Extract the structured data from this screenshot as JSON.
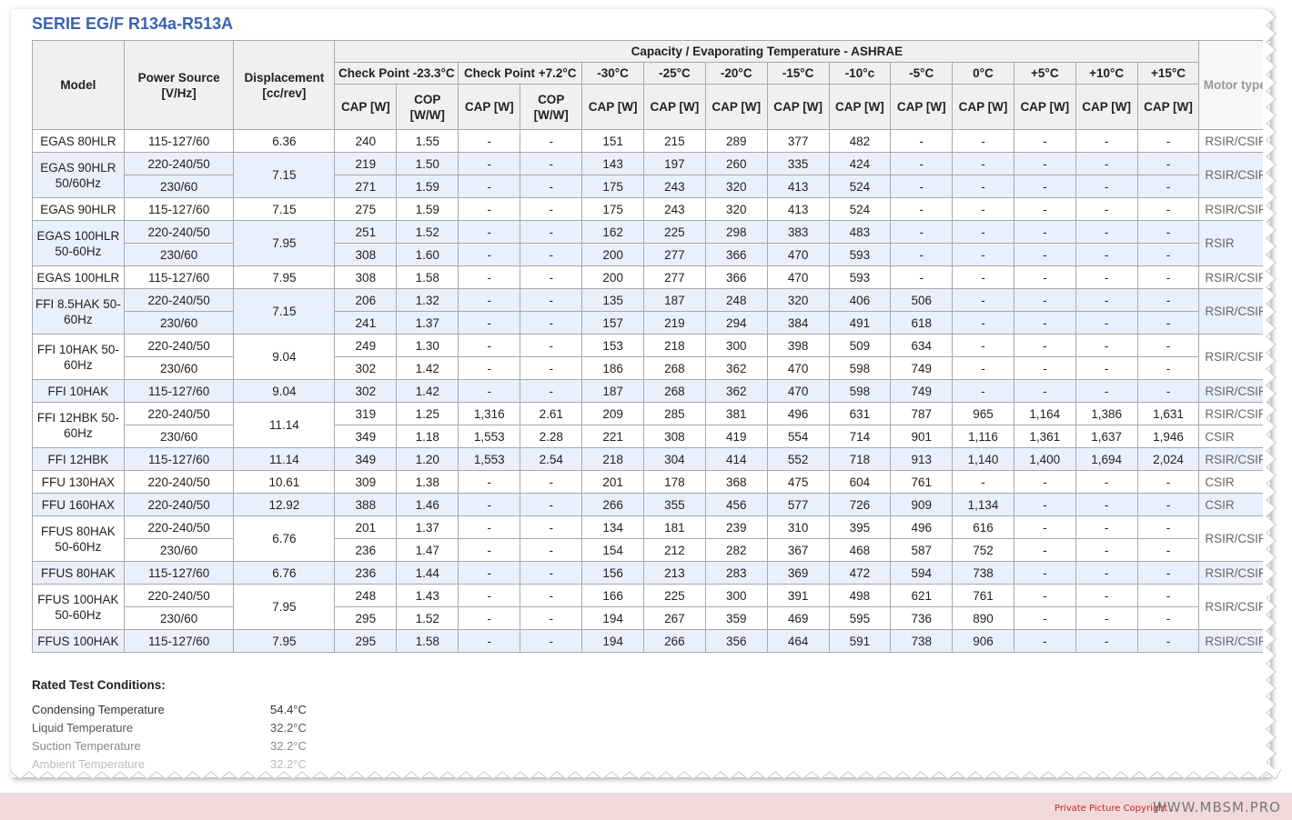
{
  "title": "SERIE EG/F R134a-R513A",
  "headers": {
    "model": "Model",
    "power": "Power Source [V/Hz]",
    "displacement": "Displacement [cc/rev]",
    "capacity_group": "Capacity / Evaporating Temperature - ASHRAE",
    "motor": "Motor type",
    "check1": "Check Point -23.3°C",
    "check2": "Check Point +7.2°C",
    "temps": [
      "-30°C",
      "-25°C",
      "-20°C",
      "-15°C",
      "-10°c",
      "-5°C",
      "0°C",
      "+5°C",
      "+10°C",
      "+15°C"
    ],
    "cap": "CAP [W]",
    "cop": "COP [W/W]"
  },
  "groups": [
    {
      "model": "EGAS 80HLR",
      "disp": "6.36",
      "rows": [
        {
          "power": "115-127/60",
          "values": [
            "240",
            "1.55",
            "-",
            "-",
            "151",
            "215",
            "289",
            "377",
            "482",
            "-",
            "-",
            "-",
            "-",
            "-"
          ],
          "motor": "RSIR/CSIR"
        }
      ]
    },
    {
      "model": "EGAS 90HLR 50/60Hz",
      "disp": "7.15",
      "motor": "RSIR/CSIR",
      "rows": [
        {
          "power": "220-240/50",
          "values": [
            "219",
            "1.50",
            "-",
            "-",
            "143",
            "197",
            "260",
            "335",
            "424",
            "-",
            "-",
            "-",
            "-",
            "-"
          ]
        },
        {
          "power": "230/60",
          "values": [
            "271",
            "1.59",
            "-",
            "-",
            "175",
            "243",
            "320",
            "413",
            "524",
            "-",
            "-",
            "-",
            "-",
            "-"
          ]
        }
      ]
    },
    {
      "model": "EGAS 90HLR",
      "disp": "7.15",
      "rows": [
        {
          "power": "115-127/60",
          "values": [
            "275",
            "1.59",
            "-",
            "-",
            "175",
            "243",
            "320",
            "413",
            "524",
            "-",
            "-",
            "-",
            "-",
            "-"
          ],
          "motor": "RSIR/CSIR"
        }
      ]
    },
    {
      "model": "EGAS 100HLR 50-60Hz",
      "disp": "7.95",
      "motor": "RSIR",
      "rows": [
        {
          "power": "220-240/50",
          "values": [
            "251",
            "1.52",
            "-",
            "-",
            "162",
            "225",
            "298",
            "383",
            "483",
            "-",
            "-",
            "-",
            "-",
            "-"
          ]
        },
        {
          "power": "230/60",
          "values": [
            "308",
            "1.60",
            "-",
            "-",
            "200",
            "277",
            "366",
            "470",
            "593",
            "-",
            "-",
            "-",
            "-",
            "-"
          ]
        }
      ]
    },
    {
      "model": "EGAS 100HLR",
      "disp": "7.95",
      "rows": [
        {
          "power": "115-127/60",
          "values": [
            "308",
            "1.58",
            "-",
            "-",
            "200",
            "277",
            "366",
            "470",
            "593",
            "-",
            "-",
            "-",
            "-",
            "-"
          ],
          "motor": "RSIR/CSIR"
        }
      ]
    },
    {
      "model": "FFI 8.5HAK 50-60Hz",
      "disp": "7.15",
      "motor": "RSIR/CSIR",
      "rows": [
        {
          "power": "220-240/50",
          "values": [
            "206",
            "1.32",
            "-",
            "-",
            "135",
            "187",
            "248",
            "320",
            "406",
            "506",
            "-",
            "-",
            "-",
            "-"
          ]
        },
        {
          "power": "230/60",
          "values": [
            "241",
            "1.37",
            "-",
            "-",
            "157",
            "219",
            "294",
            "384",
            "491",
            "618",
            "-",
            "-",
            "-",
            "-"
          ]
        }
      ]
    },
    {
      "model": "FFI 10HAK 50-60Hz",
      "disp": "9.04",
      "motor": "RSIR/CSIR",
      "rows": [
        {
          "power": "220-240/50",
          "values": [
            "249",
            "1.30",
            "-",
            "-",
            "153",
            "218",
            "300",
            "398",
            "509",
            "634",
            "-",
            "-",
            "-",
            "-"
          ]
        },
        {
          "power": "230/60",
          "values": [
            "302",
            "1.42",
            "-",
            "-",
            "186",
            "268",
            "362",
            "470",
            "598",
            "749",
            "-",
            "-",
            "-",
            "-"
          ]
        }
      ]
    },
    {
      "model": "FFI 10HAK",
      "disp": "9.04",
      "rows": [
        {
          "power": "115-127/60",
          "values": [
            "302",
            "1.42",
            "-",
            "-",
            "187",
            "268",
            "362",
            "470",
            "598",
            "749",
            "-",
            "-",
            "-",
            "-"
          ],
          "motor": "RSIR/CSIR"
        }
      ]
    },
    {
      "model": "FFI 12HBK 50-60Hz",
      "disp": "11.14",
      "rows": [
        {
          "power": "220-240/50",
          "values": [
            "319",
            "1.25",
            "1,316",
            "2.61",
            "209",
            "285",
            "381",
            "496",
            "631",
            "787",
            "965",
            "1,164",
            "1,386",
            "1,631"
          ],
          "motor": "RSIR/CSIR"
        },
        {
          "power": "230/60",
          "values": [
            "349",
            "1.18",
            "1,553",
            "2.28",
            "221",
            "308",
            "419",
            "554",
            "714",
            "901",
            "1,116",
            "1,361",
            "1,637",
            "1,946"
          ],
          "motor": "CSIR"
        }
      ]
    },
    {
      "model": "FFI 12HBK",
      "disp": "11.14",
      "rows": [
        {
          "power": "115-127/60",
          "values": [
            "349",
            "1.20",
            "1,553",
            "2.54",
            "218",
            "304",
            "414",
            "552",
            "718",
            "913",
            "1,140",
            "1,400",
            "1,694",
            "2,024"
          ],
          "motor": "RSIR/CSIR"
        }
      ]
    },
    {
      "model": "FFU 130HAX",
      "disp": "10.61",
      "rows": [
        {
          "power": "220-240/50",
          "values": [
            "309",
            "1.38",
            "-",
            "-",
            "201",
            "178",
            "368",
            "475",
            "604",
            "761",
            "-",
            "-",
            "-",
            "-"
          ],
          "motor": "CSIR"
        }
      ]
    },
    {
      "model": "FFU 160HAX",
      "disp": "12.92",
      "rows": [
        {
          "power": "220-240/50",
          "values": [
            "388",
            "1.46",
            "-",
            "-",
            "266",
            "355",
            "456",
            "577",
            "726",
            "909",
            "1,134",
            "-",
            "-",
            "-"
          ],
          "motor": "CSIR"
        }
      ]
    },
    {
      "model": "FFUS 80HAK 50-60Hz",
      "disp": "6.76",
      "motor": "RSIR/CSIR",
      "rows": [
        {
          "power": "220-240/50",
          "values": [
            "201",
            "1.37",
            "-",
            "-",
            "134",
            "181",
            "239",
            "310",
            "395",
            "496",
            "616",
            "-",
            "-",
            "-"
          ]
        },
        {
          "power": "230/60",
          "values": [
            "236",
            "1.47",
            "-",
            "-",
            "154",
            "212",
            "282",
            "367",
            "468",
            "587",
            "752",
            "-",
            "-",
            "-"
          ]
        }
      ]
    },
    {
      "model": "FFUS 80HAK",
      "disp": "6.76",
      "rows": [
        {
          "power": "115-127/60",
          "values": [
            "236",
            "1.44",
            "-",
            "-",
            "156",
            "213",
            "283",
            "369",
            "472",
            "594",
            "738",
            "-",
            "-",
            "-"
          ],
          "motor": "RSIR/CSIR"
        }
      ]
    },
    {
      "model": "FFUS 100HAK 50-60Hz",
      "disp": "7.95",
      "motor": "RSIR/CSIR",
      "rows": [
        {
          "power": "220-240/50",
          "values": [
            "248",
            "1.43",
            "-",
            "-",
            "166",
            "225",
            "300",
            "391",
            "498",
            "621",
            "761",
            "-",
            "-",
            "-"
          ]
        },
        {
          "power": "230/60",
          "values": [
            "295",
            "1.52",
            "-",
            "-",
            "194",
            "267",
            "359",
            "469",
            "595",
            "736",
            "890",
            "-",
            "-",
            "-"
          ]
        }
      ]
    },
    {
      "model": "FFUS 100HAK",
      "disp": "7.95",
      "rows": [
        {
          "power": "115-127/60",
          "values": [
            "295",
            "1.58",
            "-",
            "-",
            "194",
            "266",
            "356",
            "464",
            "591",
            "738",
            "906",
            "-",
            "-",
            "-"
          ],
          "motor": "RSIR/CSIR"
        }
      ]
    }
  ],
  "rated": {
    "title": "Rated Test Conditions:",
    "items": [
      {
        "label": "Condensing Temperature",
        "value": "54.4°C"
      },
      {
        "label": "Liquid Temperature",
        "value": "32.2°C"
      },
      {
        "label": "Suction Temperature",
        "value": "32.2°C"
      },
      {
        "label": "Ambient Temperature",
        "value": "32.2°C"
      }
    ]
  },
  "footer": {
    "copyright": "Private Picture Copyright :",
    "site": "WWW.MBSM.PRO"
  }
}
